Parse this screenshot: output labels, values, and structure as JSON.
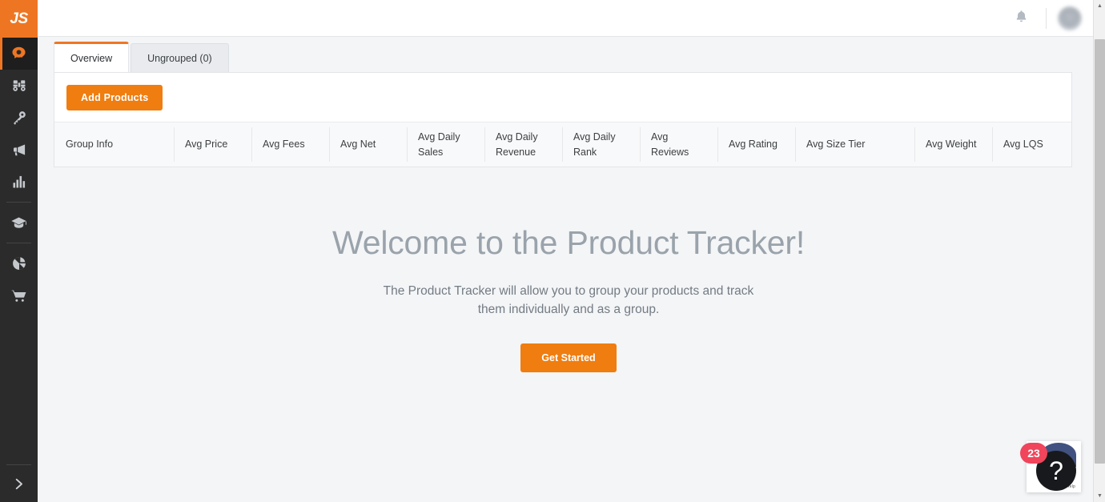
{
  "brand": {
    "logo_text": "JS"
  },
  "sidebar": {
    "items": [
      {
        "name": "product-database",
        "icon": "search-bubble-icon",
        "active": true
      },
      {
        "name": "opportunity-finder",
        "icon": "binoculars-icon",
        "active": false
      },
      {
        "name": "keyword-scout",
        "icon": "key-icon",
        "active": false
      },
      {
        "name": "launch",
        "icon": "megaphone-icon",
        "active": false
      },
      {
        "name": "analytics",
        "icon": "bar-chart-icon",
        "active": false
      },
      {
        "name": "academy",
        "icon": "graduation-cap-icon",
        "active": false
      },
      {
        "name": "market-insights",
        "icon": "pie-chart-icon",
        "active": false
      },
      {
        "name": "products",
        "icon": "shopping-cart-icon",
        "active": false
      }
    ],
    "expand_icon": "chevron-right-icon"
  },
  "topbar": {
    "notifications_icon": "bell-icon",
    "avatar_icon": "user-avatar"
  },
  "tabs": [
    {
      "label": "Overview",
      "active": true
    },
    {
      "label": "Ungrouped (0)",
      "active": false
    }
  ],
  "toolbar": {
    "add_products_label": "Add Products"
  },
  "table": {
    "columns": [
      {
        "label": "Group Info",
        "width": 149
      },
      {
        "label": "Avg Price",
        "width": 97
      },
      {
        "label": "Avg Fees",
        "width": 97
      },
      {
        "label": "Avg Net",
        "width": 97
      },
      {
        "label": "Avg Daily Sales",
        "width": 97
      },
      {
        "label": "Avg Daily Revenue",
        "width": 97
      },
      {
        "label": "Avg Daily Rank",
        "width": 97
      },
      {
        "label": "Avg Reviews",
        "width": 97
      },
      {
        "label": "Avg Rating",
        "width": 97
      },
      {
        "label": "Avg Size Tier",
        "width": 149
      },
      {
        "label": "Avg Weight",
        "width": 97
      },
      {
        "label": "Avg LQS",
        "width": 96
      }
    ]
  },
  "welcome": {
    "title": "Welcome to the Product Tracker!",
    "subtitle": "The Product Tracker will allow you to group your products and track them individually and as a group.",
    "cta_label": "Get Started"
  },
  "help": {
    "badge_count": "23",
    "icon": "question-mark-icon",
    "caption": "Help"
  },
  "colors": {
    "brand_orange": "#ee7623",
    "button_orange": "#f07d0f",
    "sidebar_dark": "#2b2b2b",
    "badge_red": "#f0455b",
    "page_background": "#f4f5f7"
  },
  "scrollbar": {
    "up_arrow": "scroll-up-arrow",
    "down_arrow": "scroll-down-arrow"
  }
}
